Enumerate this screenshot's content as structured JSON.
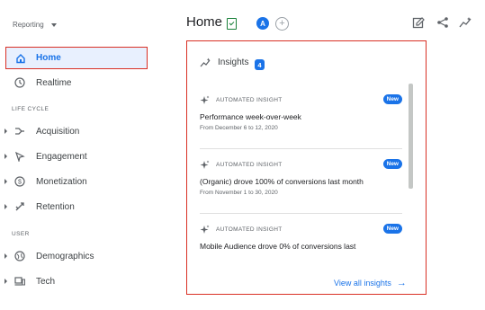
{
  "sidebar": {
    "property_selector": "Reporting",
    "items": [
      {
        "label": "Home",
        "icon": "home-icon",
        "active": true
      },
      {
        "label": "Realtime",
        "icon": "clock-icon"
      }
    ],
    "sections": [
      {
        "label": "LIFE CYCLE",
        "items": [
          {
            "label": "Acquisition",
            "icon": "acquisition-icon"
          },
          {
            "label": "Engagement",
            "icon": "engagement-icon"
          },
          {
            "label": "Monetization",
            "icon": "dollar-icon"
          },
          {
            "label": "Retention",
            "icon": "retention-icon"
          }
        ]
      },
      {
        "label": "USER",
        "items": [
          {
            "label": "Demographics",
            "icon": "globe-icon"
          },
          {
            "label": "Tech",
            "icon": "devices-icon"
          }
        ]
      }
    ]
  },
  "header": {
    "title": "Home",
    "avatar_letter": "A",
    "add_compare": "+"
  },
  "insights": {
    "title": "Insights",
    "count": "4",
    "cards": [
      {
        "type": "AUTOMATED INSIGHT",
        "badge": "New",
        "headline": "Performance week-over-week",
        "sub": "From December 6 to 12, 2020"
      },
      {
        "type": "AUTOMATED INSIGHT",
        "badge": "New",
        "headline": "(Organic) drove 100% of conversions last month",
        "sub": "From November 1 to 30, 2020"
      },
      {
        "type": "AUTOMATED INSIGHT",
        "badge": "New",
        "headline": "Mobile Audience drove 0% of conversions last",
        "sub": ""
      }
    ],
    "view_all": "View all insights",
    "view_all_arrow": "→"
  },
  "colors": {
    "accent": "#1a73e8",
    "highlight": "#d93025",
    "active_bg": "#e8f0fe"
  }
}
